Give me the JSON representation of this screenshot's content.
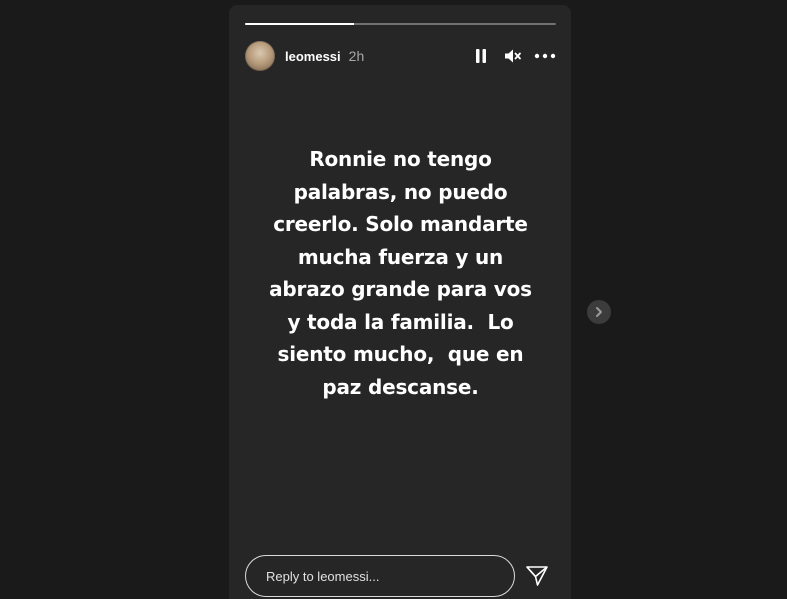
{
  "story": {
    "progress_fraction": 0.35,
    "user": {
      "username": "leomessi",
      "time": "2h",
      "avatar_icon": "profile-photo"
    },
    "controls": {
      "pause_icon": "pause-icon",
      "mute_icon": "muted-speaker-icon",
      "more_icon": "more-options-icon"
    },
    "text_lines": [
      "Ronnie no tengo",
      "palabras, no puedo",
      "creerlo. Solo mandarte",
      "mucha fuerza y un",
      "abrazo grande para vos",
      "y toda la familia.  Lo",
      "siento mucho,  que en",
      "paz descanse."
    ],
    "reply": {
      "placeholder": "Reply to leomessi...",
      "value": ""
    },
    "send_icon": "send-icon"
  },
  "navigation": {
    "next_icon": "chevron-right-icon"
  },
  "colors": {
    "background": "#1a1a1a",
    "story_background": "#262626",
    "text": "#ffffff",
    "muted_text": "#a8a8a8"
  }
}
